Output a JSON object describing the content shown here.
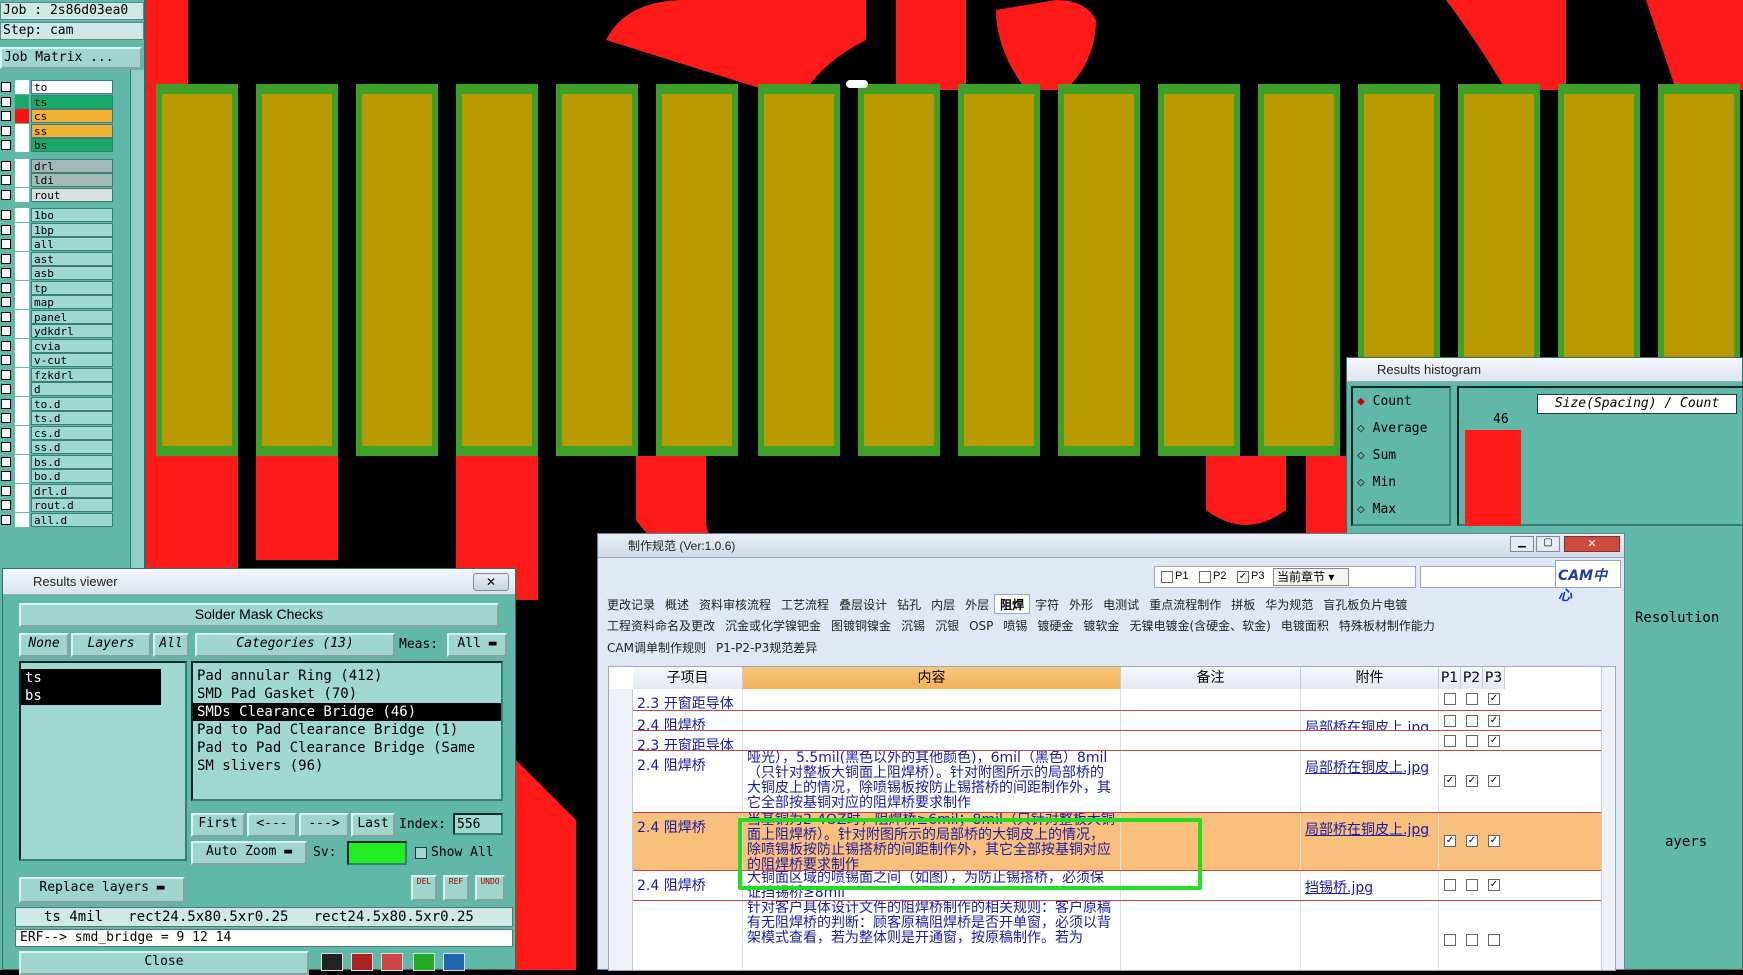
{
  "left_panel": {
    "job_label": "Job : 2s86d03ea0",
    "step_label": "Step: cam",
    "job_matrix_button": "Job Matrix ...",
    "layers": [
      {
        "name": "to",
        "color": "#ffffff",
        "swatch": "#ffffff"
      },
      {
        "name": "ts",
        "color": "#1aa86a",
        "swatch": "#1aa86a"
      },
      {
        "name": "cs",
        "color": "#f2b233",
        "swatch": "#ff1010"
      },
      {
        "name": "ss",
        "color": "#f2b233",
        "swatch": "#ffffff"
      },
      {
        "name": "bs",
        "color": "#1aa86a",
        "swatch": "#ffffff"
      },
      {
        "name": "drl",
        "color": "#a4b8b6",
        "swatch": "#ffffff"
      },
      {
        "name": "ldi",
        "color": "#a4b8b6",
        "swatch": "#ffffff"
      },
      {
        "name": "rout",
        "color": "#d8e0df",
        "swatch": "#ffffff"
      },
      {
        "name": "1bo",
        "color": "#9fd8cf",
        "swatch": "#ffffff"
      },
      {
        "name": "1bp",
        "color": "#9fd8cf",
        "swatch": "#ffffff"
      },
      {
        "name": "all",
        "color": "#9fd8cf",
        "swatch": "#ffffff"
      },
      {
        "name": "ast",
        "color": "#9fd8cf",
        "swatch": "#ffffff"
      },
      {
        "name": "asb",
        "color": "#9fd8cf",
        "swatch": "#ffffff"
      },
      {
        "name": "tp",
        "color": "#9fd8cf",
        "swatch": "#ffffff"
      },
      {
        "name": "map",
        "color": "#9fd8cf",
        "swatch": "#ffffff"
      },
      {
        "name": "panel",
        "color": "#9fd8cf",
        "swatch": "#ffffff"
      },
      {
        "name": "ydkdrl",
        "color": "#9fd8cf",
        "swatch": "#ffffff"
      },
      {
        "name": "cvia",
        "color": "#9fd8cf",
        "swatch": "#ffffff"
      },
      {
        "name": "v-cut",
        "color": "#9fd8cf",
        "swatch": "#ffffff"
      },
      {
        "name": "fzkdrl",
        "color": "#9fd8cf",
        "swatch": "#ffffff"
      },
      {
        "name": "d",
        "color": "#9fd8cf",
        "swatch": "#ffffff"
      },
      {
        "name": "to.d",
        "color": "#9fd8cf",
        "swatch": "#ffffff"
      },
      {
        "name": "ts.d",
        "color": "#9fd8cf",
        "swatch": "#ffffff"
      },
      {
        "name": "cs.d",
        "color": "#9fd8cf",
        "swatch": "#ffffff"
      },
      {
        "name": "ss.d",
        "color": "#9fd8cf",
        "swatch": "#ffffff"
      },
      {
        "name": "bs.d",
        "color": "#9fd8cf",
        "swatch": "#ffffff"
      },
      {
        "name": "bo.d",
        "color": "#9fd8cf",
        "swatch": "#ffffff"
      },
      {
        "name": "drl.d",
        "color": "#9fd8cf",
        "swatch": "#ffffff"
      },
      {
        "name": "rout.d",
        "color": "#9fd8cf",
        "swatch": "#ffffff"
      },
      {
        "name": "all.d",
        "color": "#9fd8cf",
        "swatch": "#ffffff"
      }
    ]
  },
  "results_viewer": {
    "title": "Results viewer",
    "close_x": "✕",
    "header": "Solder Mask Checks",
    "none_btn": "None",
    "layers_btn": "Layers",
    "all_btn": "All",
    "categories_label": "Categories (13)",
    "meas_label": "Meas:",
    "meas_value": "All",
    "layer_items": [
      "ts",
      "bs"
    ],
    "categories": [
      "Pad annular Ring (412)",
      "SMD Pad Gasket (70)",
      "SMDs Clearance Bridge (46)",
      "Pad to Pad Clearance Bridge (1)",
      "Pad to Pad Clearance Bridge (Same",
      "SM slivers (96)"
    ],
    "selected_index": 2,
    "first_btn": "First",
    "prev_btn": "<---",
    "next_btn": "--->",
    "last_btn": "Last",
    "index_label": "Index:",
    "index_value": "556",
    "auto_zoom": "Auto Zoom",
    "sv_label": "Sv:",
    "show_all": "Show All",
    "replace_layers": "Replace layers",
    "del_btn": "DEL",
    "ref_btn": "REF",
    "undo_btn": "UNDO",
    "status_line": "ts 4mil   rect24.5x80.5xr0.25   rect24.5x80.5xr0.25",
    "erf_line": "ERF--> smd_bridge = 9 12 14",
    "close_btn": "Close"
  },
  "histogram": {
    "title": "Results histogram",
    "options": [
      "Count",
      "Average",
      "Sum",
      "Min",
      "Max"
    ],
    "selected": "Count",
    "chart_title": "Size(Spacing) / Count",
    "bar_value": "46",
    "resolution_label": "Resolution",
    "layers_label": "ayers"
  },
  "spec_window": {
    "title": "制作规范 (Ver:1.0.6)",
    "p1": "P1",
    "p2": "P2",
    "p3": "P3",
    "scope_select": "当前章节",
    "search_placeholder": "",
    "logo_text": "CAM中心",
    "tabs_row1": [
      "更改记录",
      "概述",
      "资料审核流程",
      "工艺流程",
      "叠层设计",
      "钻孔",
      "内层",
      "外层",
      "阻焊",
      "字符",
      "外形",
      "电测试",
      "重点流程制作",
      "拼板",
      "华为规范",
      "盲孔板负片电镀"
    ],
    "active_tab": "阻焊",
    "tabs_row2": [
      "工程资料命名及更改",
      "沉金或化学镍钯金",
      "图镀铜镍金",
      "沉锡",
      "沉银",
      "OSP",
      "喷锡",
      "镀硬金",
      "镀软金",
      "无镍电镀金(含硬金、软金)",
      "电镀面积",
      "特殊板材制作能力"
    ],
    "tabs_row3": [
      "CAM调单制作规则",
      "P1-P2-P3规范差异"
    ],
    "columns": [
      "子项目",
      "内容",
      "备注",
      "附件",
      "P1",
      "P2",
      "P3"
    ],
    "rows": [
      {
        "sub": "2.3 开窗距导体",
        "content": "",
        "note": "",
        "attach": "",
        "p1": false,
        "p2": false,
        "p3": true
      },
      {
        "sub": "2.4 阻焊桥",
        "content": "",
        "note": "",
        "attach": "局部桥在铜皮上.jpg",
        "p1": false,
        "p2": false,
        "p3": true
      },
      {
        "sub": "2.3 开窗距导体",
        "content": "",
        "note": "",
        "attach": "",
        "p1": false,
        "p2": false,
        "p3": true
      },
      {
        "sub": "2.4 阻焊桥",
        "content": "哑光），5.5mil(黑色以外的其他颜色)，6mil（黑色）8mil（只针对整板大铜面上阻焊桥）。针对附图所示的局部桥的大铜皮上的情况，除喷锡板按防止锡搭桥的间距制作外，其它全部按基铜对应的阻焊桥要求制作",
        "note": "",
        "attach": "局部桥在铜皮上.jpg",
        "p1": true,
        "p2": true,
        "p3": true
      },
      {
        "sub": "2.4 阻焊桥",
        "content": "当基铜为2-4OZ时，阻焊桥≥6mil；8mil（只针对整板大铜面上阻焊桥）。针对附图所示的局部桥的大铜皮上的情况，除喷锡板按防止锡搭桥的间距制作外，其它全部按基铜对应的阻焊桥要求制作",
        "note": "",
        "attach": "局部桥在铜皮上.jpg",
        "p1": true,
        "p2": true,
        "p3": true
      },
      {
        "sub": "2.4 阻焊桥",
        "content": "大铜面区域的喷锡面之间（如图），为防止锡搭桥，必须保证挡锡桥≥8mil",
        "note": "",
        "attach": "挡锡桥.jpg",
        "p1": false,
        "p2": false,
        "p3": true
      },
      {
        "sub": "",
        "content": "针对客户具体设计文件的阻焊桥制作的相关规则：客户原稿有无阻焊桥的判断：顾客原稿阻焊桥是否开单窗，必须以背架模式查看，若为整体则是开通窗，按原稿制作。若为",
        "note": "",
        "attach": "",
        "p1": false,
        "p2": false,
        "p3": false
      }
    ],
    "highlight_row": 4
  },
  "colors": {
    "copper_red": "#ff1a1a",
    "pad_gold": "#b89a00",
    "mask_green": "#3fa028",
    "panel_teal": "#5fb8a8",
    "highlight_green": "#22dd22"
  }
}
